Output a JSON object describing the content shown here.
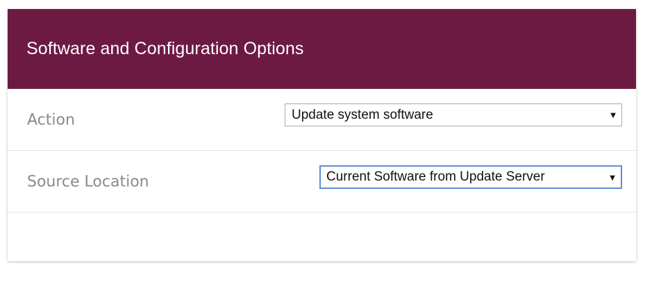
{
  "panel": {
    "title": "Software and Configuration Options",
    "header_color": "#6d1a42"
  },
  "rows": [
    {
      "label": "Action",
      "selected": "Update system software",
      "arrow_icon": "triangle-down-icon"
    },
    {
      "label": "Source Location",
      "selected": "Current Software from Update Server",
      "arrow_icon": "triangle-down-icon"
    }
  ]
}
